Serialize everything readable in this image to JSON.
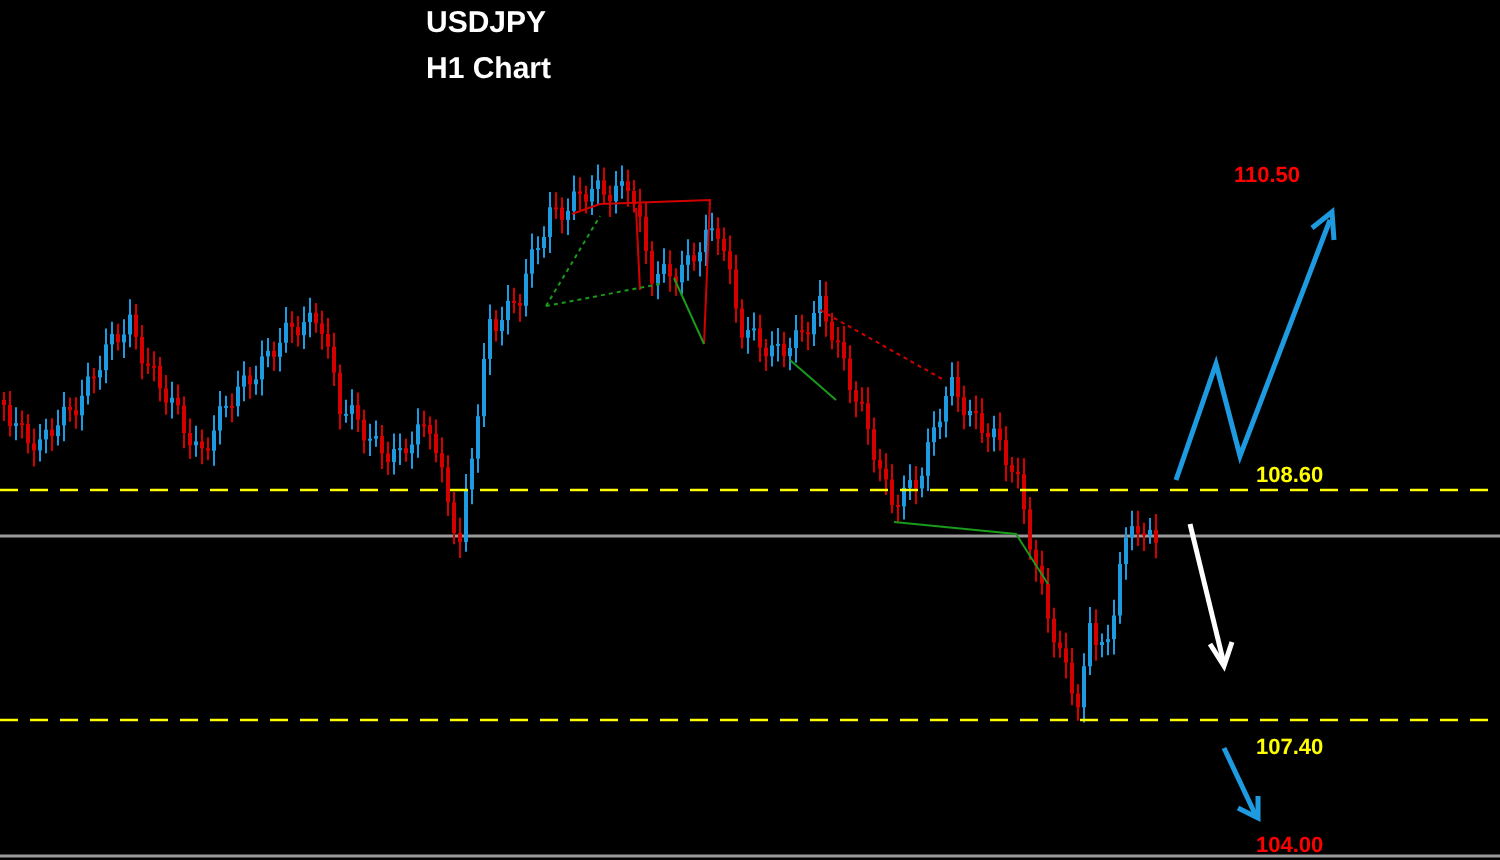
{
  "chart": {
    "symbol": "USDJPY",
    "timeframe": "H1 Chart",
    "levels": [
      {
        "label": "110.50",
        "color": "#ff0000",
        "kind": "target"
      },
      {
        "label": "108.60",
        "color": "#ffff00",
        "kind": "level"
      },
      {
        "label": "107.40",
        "color": "#ffff00",
        "kind": "level"
      },
      {
        "label": "104.00",
        "color": "#ff0000",
        "kind": "target"
      }
    ]
  }
}
